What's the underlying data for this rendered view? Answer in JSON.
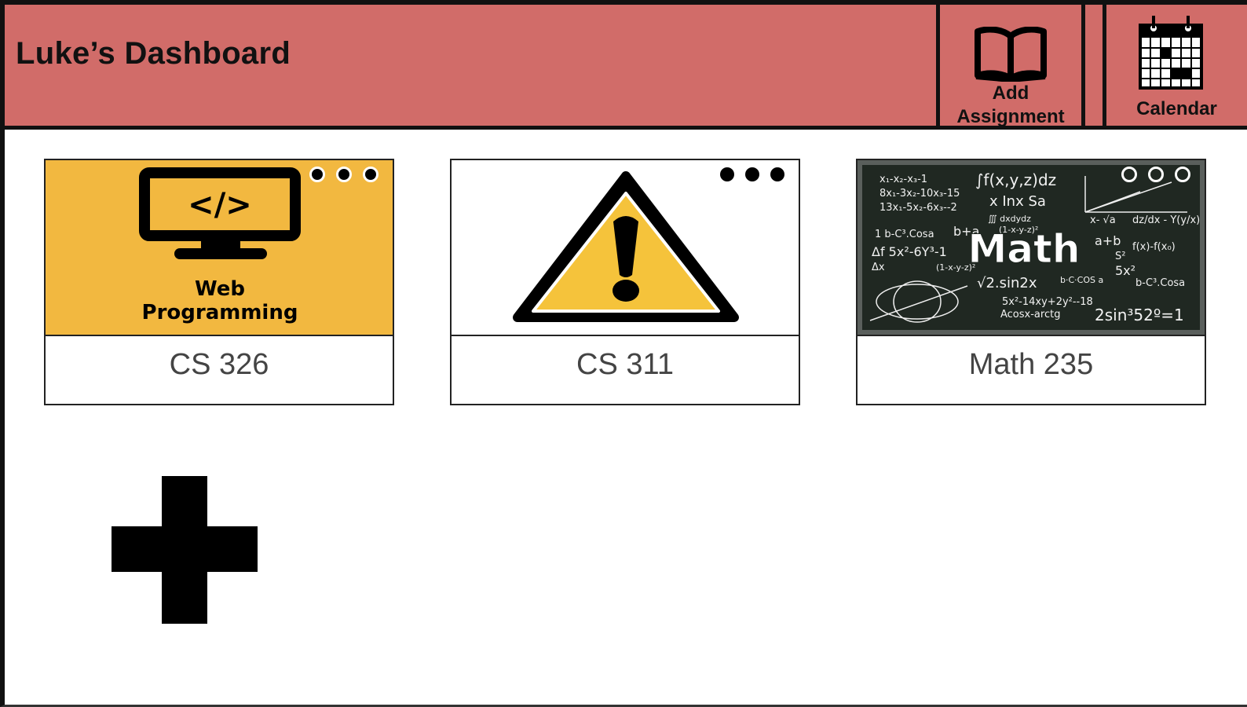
{
  "header": {
    "title": "Luke’s Dashboard",
    "add_assignment": {
      "label": "Add Assignment",
      "icon": "open-book-icon"
    },
    "calendar": {
      "label": "Calendar",
      "icon": "calendar-icon"
    }
  },
  "courses": [
    {
      "name": "CS 326",
      "image_text": [
        "Web",
        "Programming"
      ],
      "image_icon": "monitor-code-icon",
      "image_bg": "#f2b840"
    },
    {
      "name": "CS 311",
      "image_icon": "warning-icon",
      "image_bg": "#ffffff"
    },
    {
      "name": "Math 235",
      "image_text": [
        "Math"
      ],
      "image_icon": "chalkboard-math",
      "image_bg": "#202822"
    }
  ],
  "add_course": {
    "icon": "plus-icon"
  },
  "colors": {
    "header_bg": "#d16c69",
    "web_bg": "#f2b840",
    "warning_yellow": "#f5c33b",
    "chalkboard": "#202822"
  }
}
